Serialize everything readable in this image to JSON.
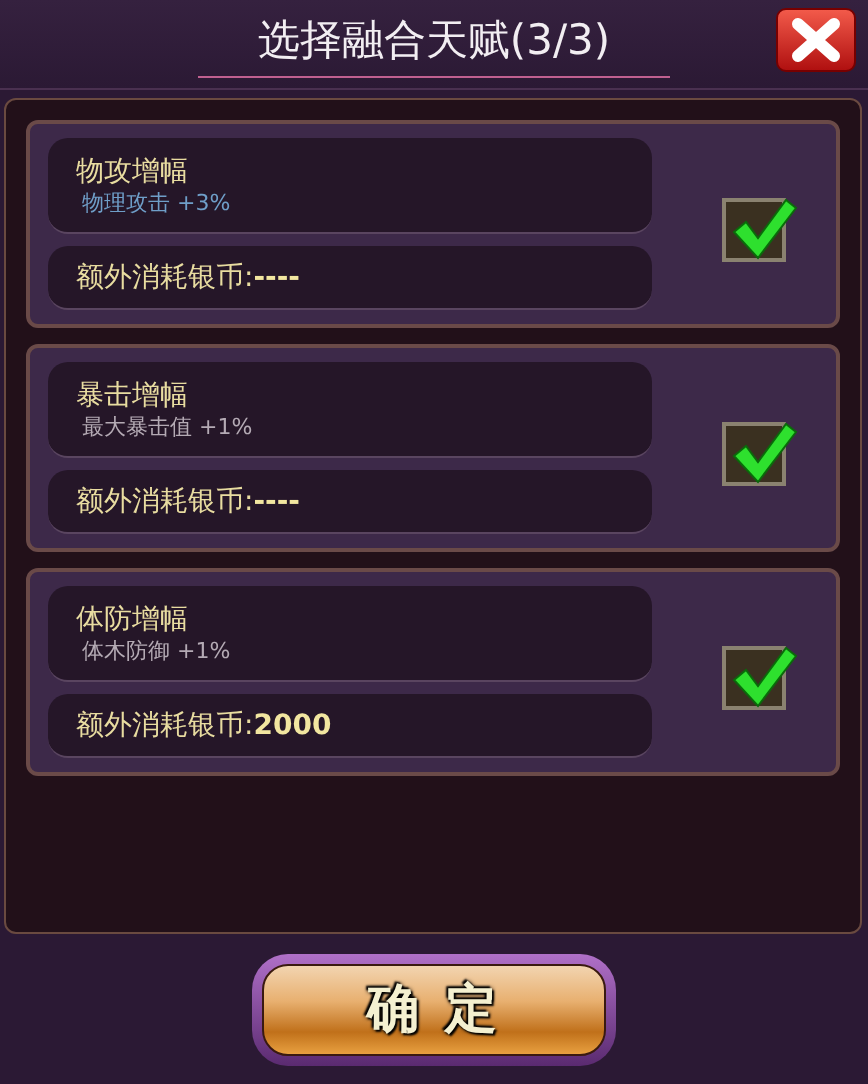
{
  "window": {
    "title": "选择融合天赋(3/3)"
  },
  "talents": [
    {
      "name": "物攻增幅",
      "description": "物理攻击 +3%",
      "color": "#6f9ec8",
      "cost_label": "额外消耗银币:",
      "cost_value": "----",
      "checked": true
    },
    {
      "name": "暴击增幅",
      "description": "最大暴击值 +1%",
      "color": "#b4aab4",
      "cost_label": "额外消耗银币:",
      "cost_value": "----",
      "checked": true
    },
    {
      "name": "体防增幅",
      "description": "体木防御 +1%",
      "color": "#b4aab4",
      "cost_label": "额外消耗银币:",
      "cost_value": "2000",
      "checked": true
    }
  ],
  "confirm_button": {
    "label": "确 定"
  }
}
